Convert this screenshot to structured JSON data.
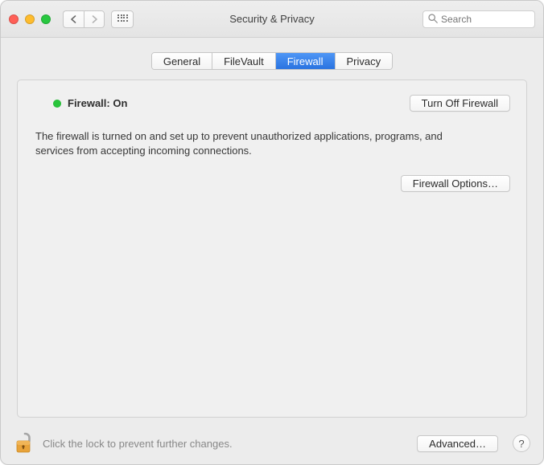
{
  "window": {
    "title": "Security & Privacy"
  },
  "toolbar": {
    "search_placeholder": "Search"
  },
  "tabs": [
    {
      "label": "General",
      "active": false
    },
    {
      "label": "FileVault",
      "active": false
    },
    {
      "label": "Firewall",
      "active": true
    },
    {
      "label": "Privacy",
      "active": false
    }
  ],
  "firewall": {
    "status_label": "Firewall: On",
    "status_color": "#29c43b",
    "toggle_button": "Turn Off Firewall",
    "description": "The firewall is turned on and set up to prevent unauthorized applications, programs, and services from accepting incoming connections.",
    "options_button": "Firewall Options…"
  },
  "footer": {
    "lock_state": "unlocked",
    "lock_message": "Click the lock to prevent further changes.",
    "advanced_button": "Advanced…",
    "help_label": "?"
  }
}
